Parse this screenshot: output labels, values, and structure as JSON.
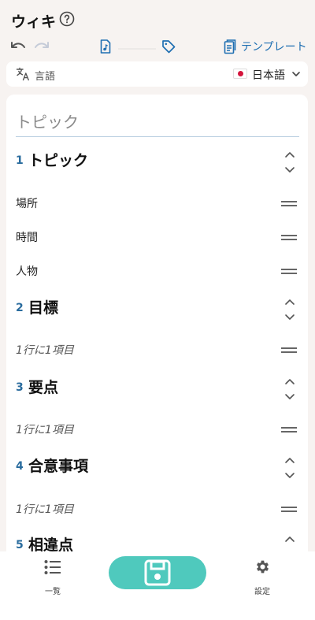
{
  "header": {
    "title": "ウィキ"
  },
  "toolbar": {
    "template_label": "テンプレート"
  },
  "language": {
    "label": "言語",
    "selected": "日本語"
  },
  "title_field": {
    "placeholder": "トピック",
    "value": ""
  },
  "sections": [
    {
      "number": "1",
      "title": "トピック",
      "items": [
        "場所",
        "時間",
        "人物"
      ]
    },
    {
      "number": "2",
      "title": "目標",
      "items": [
        "1行に1項目"
      ]
    },
    {
      "number": "3",
      "title": "要点",
      "items": [
        "1行に1項目"
      ]
    },
    {
      "number": "4",
      "title": "合意事項",
      "items": [
        "1行に1項目"
      ]
    },
    {
      "number": "5",
      "title": "相違点",
      "items": []
    }
  ],
  "nav": {
    "list_label": "一覧",
    "settings_label": "設定"
  },
  "colors": {
    "accent": "#1f6fb2",
    "section_number": "#2a6c9e",
    "save_button": "#4fc9bd",
    "background": "#f7f3f1"
  }
}
